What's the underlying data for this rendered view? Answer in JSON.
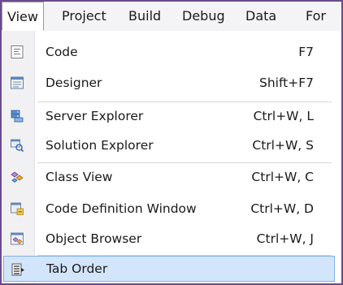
{
  "menubar": {
    "items": [
      "View",
      "Project",
      "Build",
      "Debug",
      "Data",
      "For"
    ]
  },
  "menu": {
    "items": [
      {
        "label": "Code",
        "shortcut": "F7",
        "icon": "code-icon"
      },
      {
        "label": "Designer",
        "shortcut": "Shift+F7",
        "icon": "designer-icon"
      },
      {
        "label": "Server Explorer",
        "shortcut": "Ctrl+W, L",
        "icon": "server-explorer-icon"
      },
      {
        "label": "Solution Explorer",
        "shortcut": "Ctrl+W, S",
        "icon": "solution-explorer-icon"
      },
      {
        "label": "Class View",
        "shortcut": "Ctrl+W, C",
        "icon": "class-view-icon"
      },
      {
        "label": "Code Definition Window",
        "shortcut": "Ctrl+W, D",
        "icon": "code-definition-window-icon"
      },
      {
        "label": "Object Browser",
        "shortcut": "Ctrl+W, J",
        "icon": "object-browser-icon"
      },
      {
        "label": "Tab Order",
        "shortcut": "",
        "icon": "tab-order-icon"
      }
    ],
    "highlighted_item": "Tab Order"
  },
  "colors": {
    "frame_border": "#6a4a8c",
    "highlight_fill": "#d2e5fb",
    "highlight_border": "#82b1e8",
    "gutter": "#f1f1f3"
  }
}
